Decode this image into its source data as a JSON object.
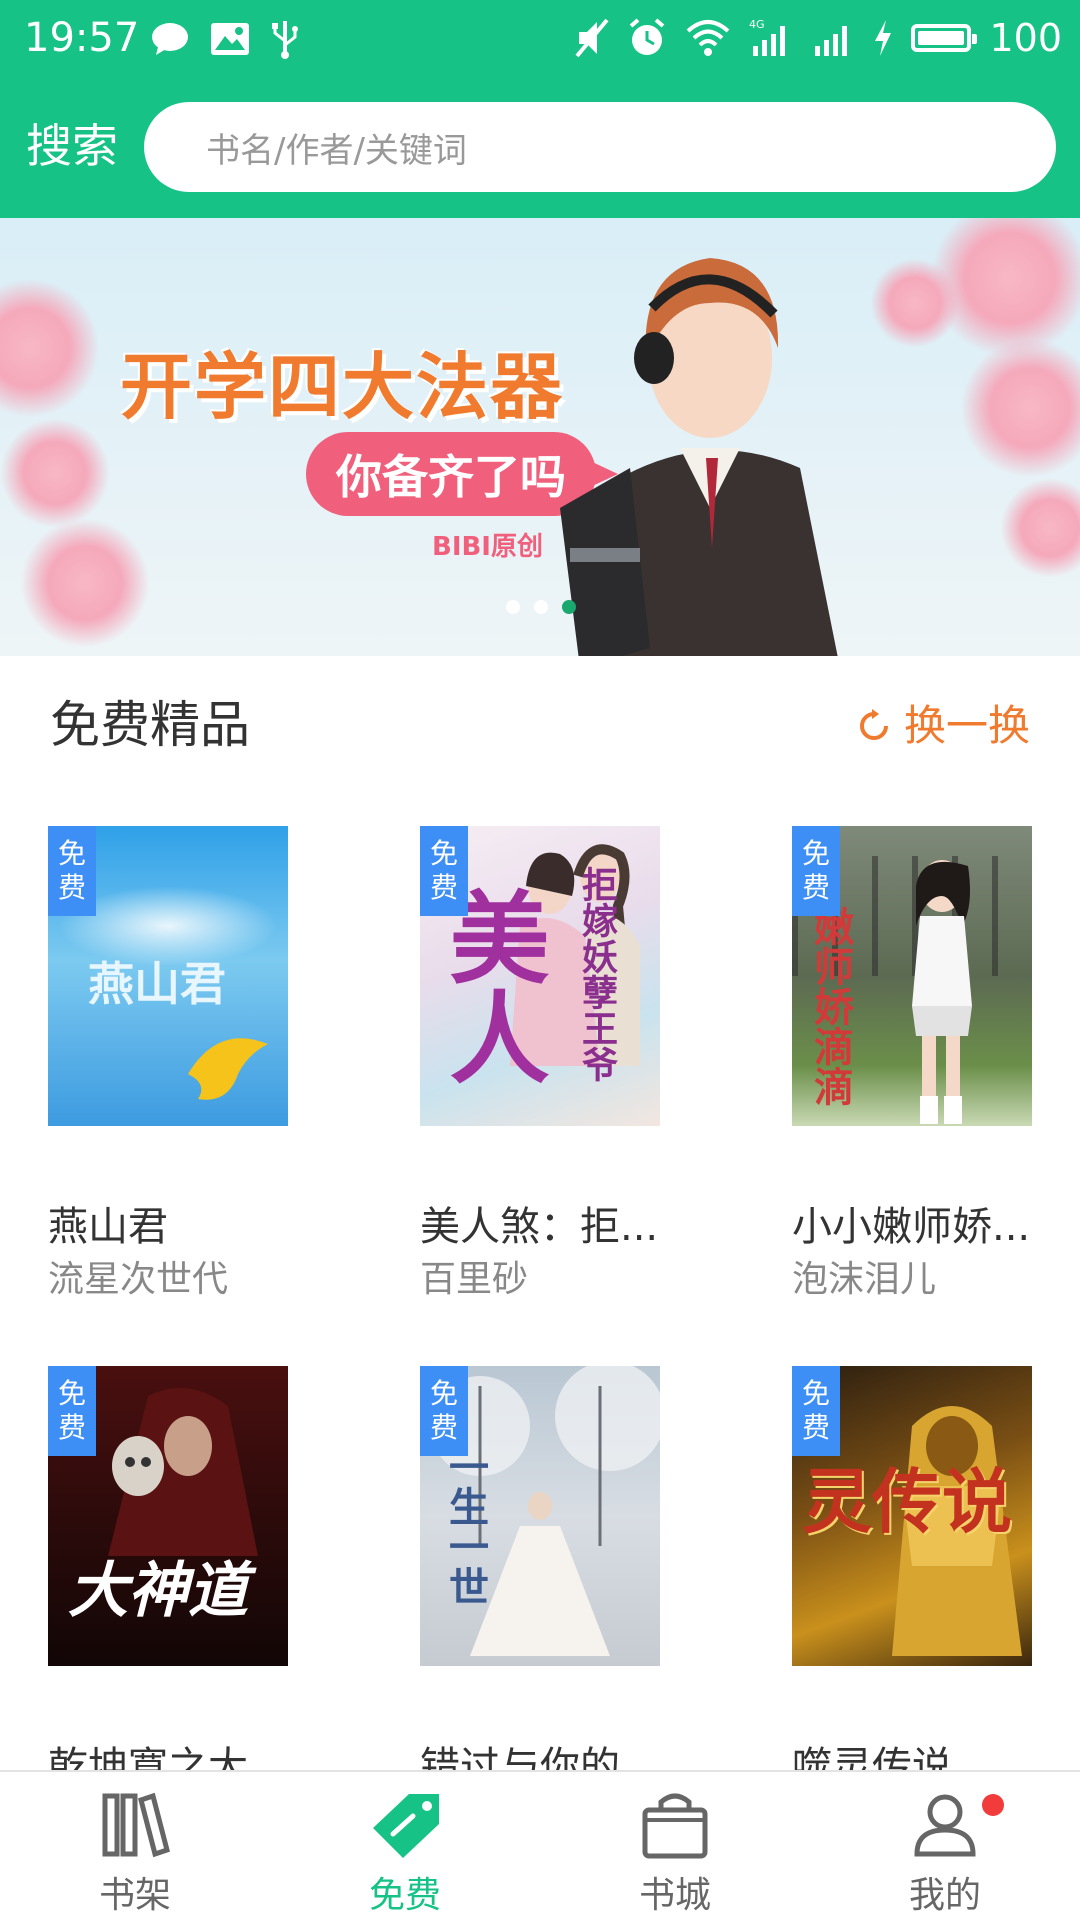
{
  "status_bar": {
    "time": "19:57",
    "battery": "100",
    "icons_left": [
      "chat-bubble-icon",
      "image-icon",
      "usb-icon"
    ],
    "icons_right": [
      "mute-icon",
      "alarm-icon",
      "wifi-icon",
      "signal-4g-icon",
      "signal-icon",
      "charging-icon",
      "battery-icon"
    ]
  },
  "header": {
    "label": "搜索",
    "search_placeholder": "书名/作者/关键词"
  },
  "banner": {
    "title": "开学四大法器",
    "pill": "你备齐了吗",
    "sub": "BIBI原创",
    "dots_total": 3,
    "dots_active_index": 2
  },
  "section": {
    "title": "免费精品",
    "refresh_label": "换一换"
  },
  "books": [
    {
      "title": "燕山君",
      "author": "流星次世代",
      "tag": [
        "免",
        "费"
      ],
      "cover_text": "燕山君"
    },
    {
      "title": "美人煞：拒...",
      "author": "百里砂",
      "tag": [
        "免",
        "费"
      ],
      "cover_text": "拒嫁妖孽王爷"
    },
    {
      "title": "小小嫩师娇...",
      "author": "泡沫泪儿",
      "tag": [
        "免",
        "费"
      ],
      "cover_text": "嫩师娇滴滴"
    },
    {
      "title": "乾坤寞之大...",
      "author": "",
      "tag": [
        "免",
        "费"
      ],
      "cover_text": "大神道"
    },
    {
      "title": "错过与你的...",
      "author": "",
      "tag": [
        "免",
        "费"
      ],
      "cover_text": "一生一世"
    },
    {
      "title": "噬灵传说",
      "author": "",
      "tag": [
        "免",
        "费"
      ],
      "cover_text": "灵传说"
    }
  ],
  "bottom_nav": [
    {
      "label": "书架",
      "icon": "bookshelf-icon",
      "active": false
    },
    {
      "label": "免费",
      "icon": "tag-icon",
      "active": true
    },
    {
      "label": "书城",
      "icon": "shopping-bag-icon",
      "active": false
    },
    {
      "label": "我的",
      "icon": "user-icon",
      "active": false,
      "badge": true
    }
  ],
  "colors": {
    "accent_green": "#16c285",
    "free_tag_blue": "#3d8ff5",
    "refresh_orange": "#f07a2d",
    "badge_red": "#f23c3c"
  }
}
